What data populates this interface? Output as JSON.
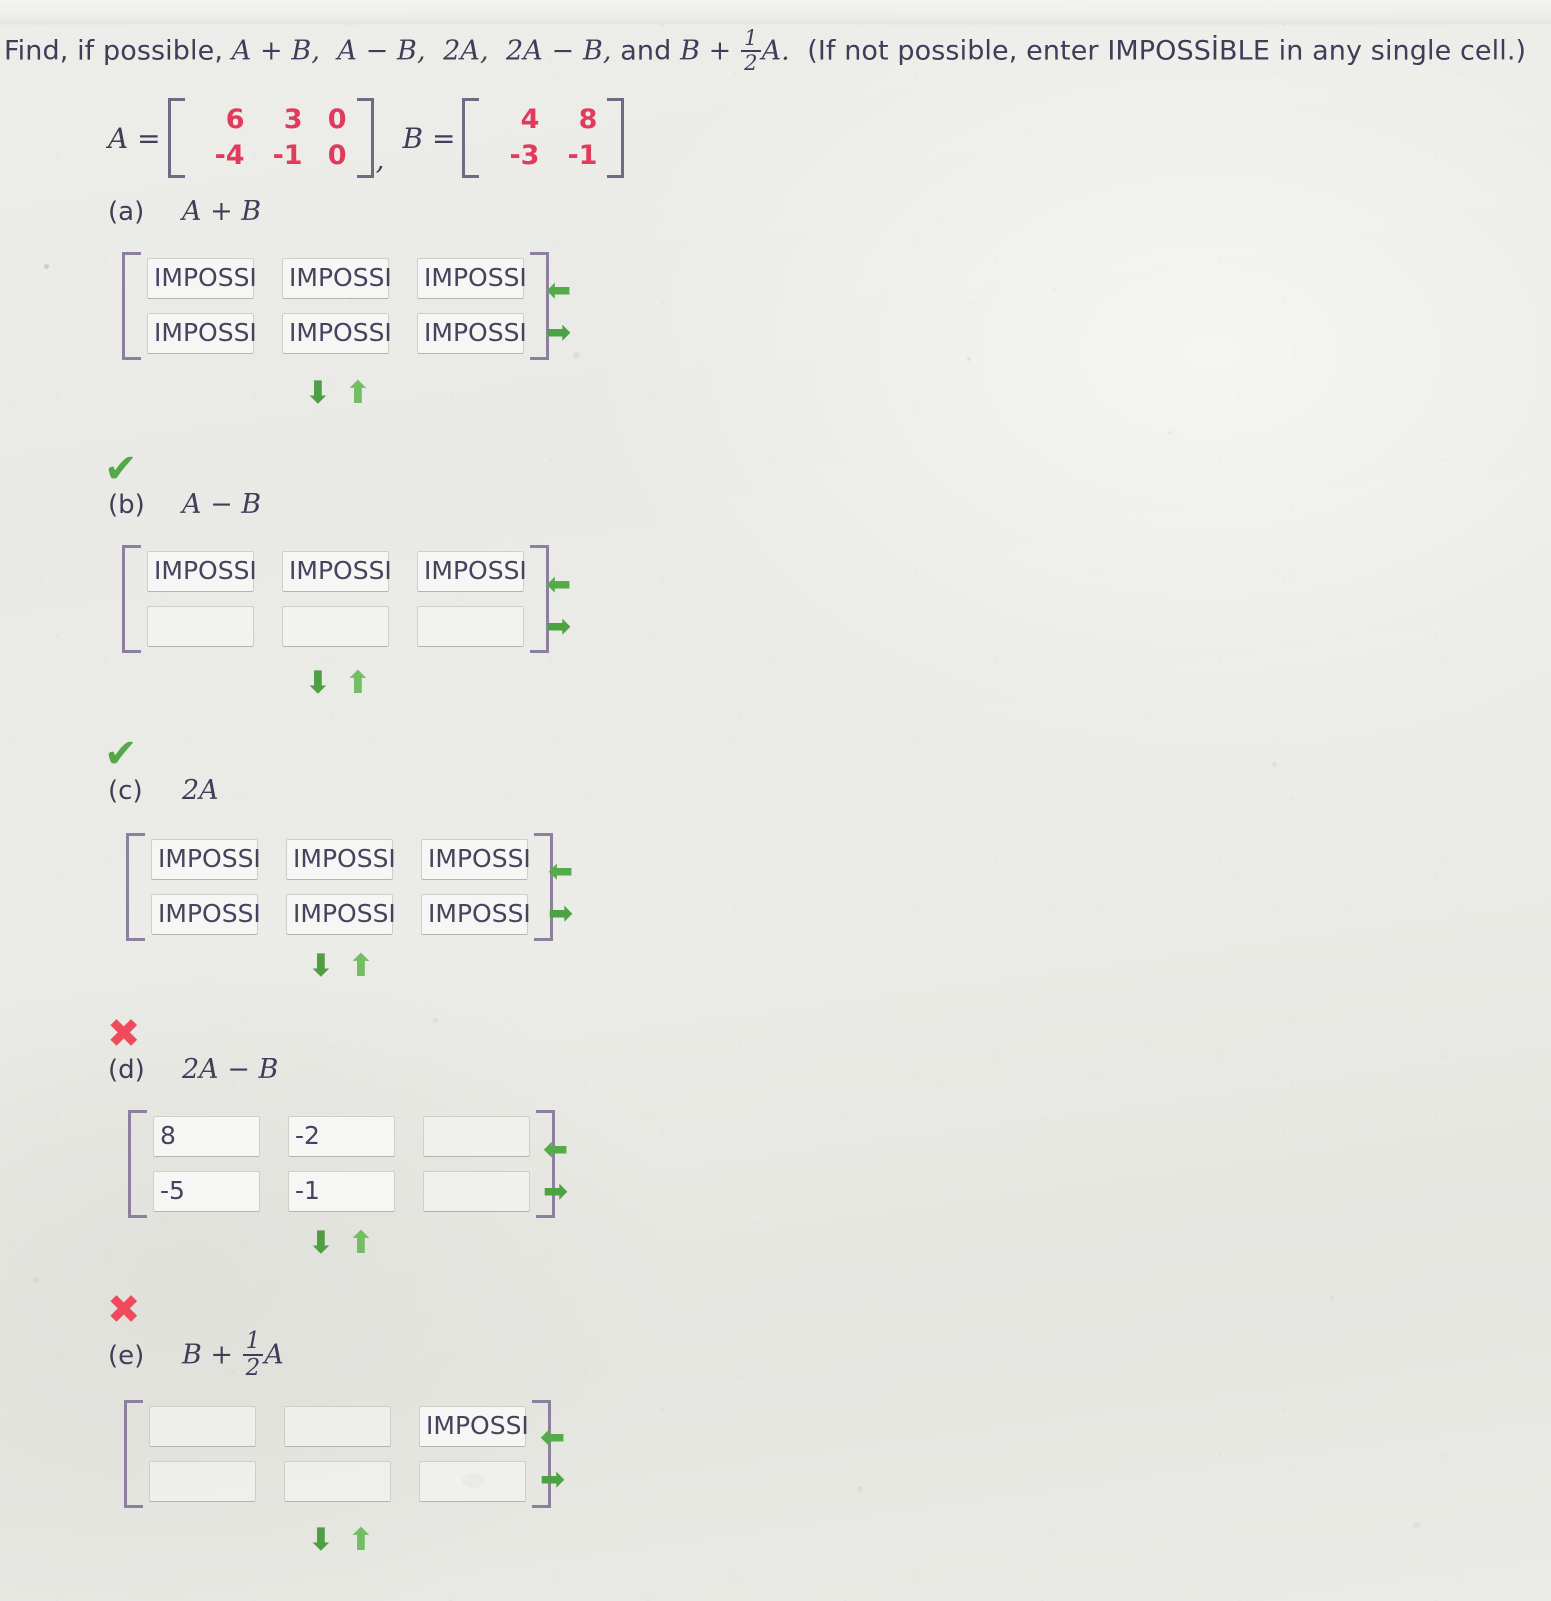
{
  "prompt": {
    "lead": "Find, if possible, ",
    "terms": [
      "A + B,",
      "A − B,",
      "2A,",
      "2A − B,"
    ],
    "and_word": "and ",
    "last_term_prefix": "B + ",
    "fraction": {
      "numerator": "1",
      "denominator": "2"
    },
    "last_term_suffix": "A.",
    "note": "(If not possible, enter IMPOSSİBLE in any single cell.)"
  },
  "givens": [
    {
      "name": "A",
      "label": "A =",
      "rows": [
        [
          "6",
          "3",
          "0"
        ],
        [
          "-4",
          "-1",
          "0"
        ]
      ]
    },
    {
      "name": "B",
      "label": "B =",
      "rows": [
        [
          "4",
          "8"
        ],
        [
          "-3",
          "-1"
        ]
      ]
    }
  ],
  "given_separator": ",",
  "colors": {
    "matrix_value": "#e23a5c",
    "text": "#3f3e58",
    "correct": "#55a84a",
    "wrong": "#ef4b5c",
    "arrow_green": "#4fa845",
    "bracket": "#8d7f9e"
  },
  "icons": {
    "check": "✔",
    "cross": "✖",
    "arrow_left": "⬅",
    "arrow_right": "➡",
    "arrow_down": "⬇",
    "arrow_up": "⬆"
  },
  "parts": [
    {
      "tag": "(a)",
      "expression": "A + B",
      "verdict": null,
      "rows": [
        [
          "IMPOSSI",
          "IMPOSSI",
          "IMPOSSI"
        ],
        [
          "IMPOSSI",
          "IMPOSSI",
          "IMPOSSI"
        ]
      ]
    },
    {
      "tag": "(b)",
      "expression": "A − B",
      "verdict": "correct",
      "rows": [
        [
          "IMPOSSI",
          "IMPOSSI",
          "IMPOSSI"
        ],
        [
          "",
          "",
          ""
        ]
      ]
    },
    {
      "tag": "(c)",
      "expression": "2A",
      "verdict": "correct",
      "rows": [
        [
          "IMPOSSI",
          "IMPOSSI",
          "IMPOSSI"
        ],
        [
          "IMPOSSI",
          "IMPOSSI",
          "IMPOSSI"
        ]
      ]
    },
    {
      "tag": "(d)",
      "expression": "2A − B",
      "verdict": "wrong",
      "rows": [
        [
          "8",
          "-2",
          ""
        ],
        [
          "-5",
          "-1",
          ""
        ]
      ]
    },
    {
      "tag": "(e)",
      "expression_prefix": "B + ",
      "expression_fraction": {
        "numerator": "1",
        "denominator": "2"
      },
      "expression_suffix": "A",
      "expression": "B + 1/2 A",
      "verdict": "wrong",
      "rows": [
        [
          "",
          "",
          "IMPOSSI"
        ],
        [
          "",
          "",
          ""
        ]
      ]
    }
  ]
}
